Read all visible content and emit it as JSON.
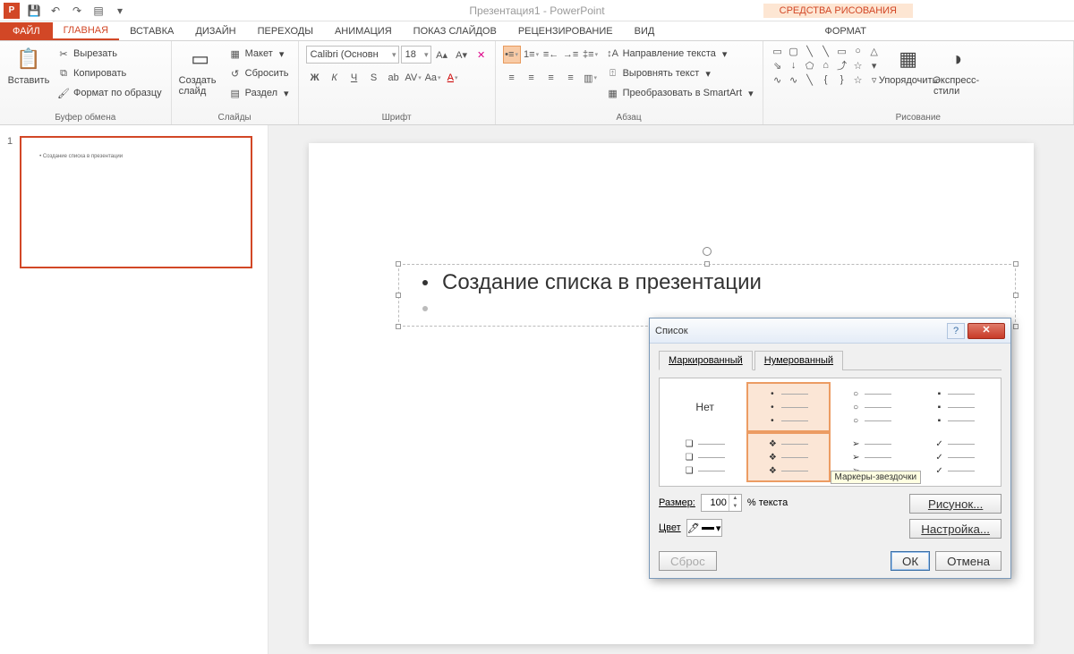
{
  "app": {
    "title": "Презентация1 - PowerPoint",
    "context_tab": "СРЕДСТВА РИСОВАНИЯ"
  },
  "tabs": {
    "file": "ФАЙЛ",
    "home": "ГЛАВНАЯ",
    "insert": "ВСТАВКА",
    "design": "ДИЗАЙН",
    "transitions": "ПЕРЕХОДЫ",
    "animations": "АНИМАЦИЯ",
    "slideshow": "ПОКАЗ СЛАЙДОВ",
    "review": "РЕЦЕНЗИРОВАНИЕ",
    "view": "ВИД",
    "format": "ФОРМАТ"
  },
  "ribbon": {
    "clipboard": {
      "label": "Буфер обмена",
      "paste": "Вставить",
      "cut": "Вырезать",
      "copy": "Копировать",
      "fmtpainter": "Формат по образцу"
    },
    "slides": {
      "label": "Слайды",
      "new": "Создать слайд",
      "layout": "Макет",
      "reset": "Сбросить",
      "section": "Раздел"
    },
    "font": {
      "label": "Шрифт",
      "name": "Calibri (Основн",
      "size": "18"
    },
    "paragraph": {
      "label": "Абзац",
      "textdir": "Направление текста",
      "align": "Выровнять текст",
      "smartart": "Преобразовать в SmartArt"
    },
    "drawing": {
      "label": "Рисование",
      "arrange": "Упорядочить",
      "quick": "Экспресс-стили"
    }
  },
  "thumb": {
    "num": "1",
    "text": "Создание списка в презентации"
  },
  "slide": {
    "bullet_text": "Создание списка в презентации"
  },
  "dialog": {
    "title": "Список",
    "tab_bulleted": "Маркированный",
    "tab_numbered": "Нумерованный",
    "none": "Нет",
    "tooltip": "Маркеры-звездочки",
    "size_label": "Размер:",
    "size_value": "100",
    "size_suffix": "% текста",
    "color_label": "Цвет",
    "picture": "Рисунок...",
    "customize": "Настройка...",
    "reset": "Сброс",
    "ok": "ОК",
    "cancel": "Отмена"
  }
}
